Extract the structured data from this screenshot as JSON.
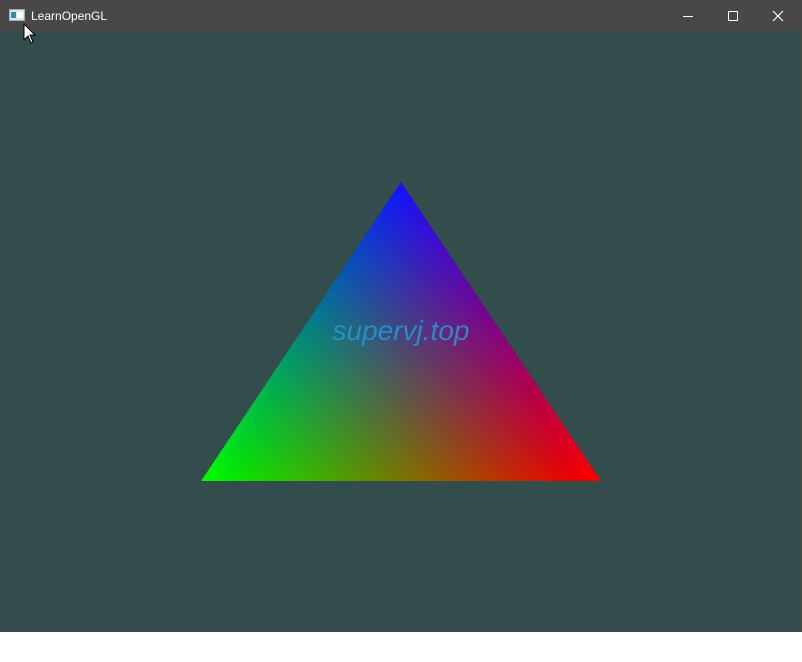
{
  "window": {
    "title": "LearnOpenGL",
    "icon": "opengl-window-icon",
    "controls": {
      "minimize_icon": "minimize-icon",
      "maximize_icon": "maximize-icon",
      "close_icon": "close-icon"
    }
  },
  "scene": {
    "clear_color": "#334d4d",
    "triangle": {
      "vertex_colors": {
        "top": "#0000ff",
        "bottom_left": "#00ff00",
        "bottom_right": "#ff0000"
      }
    },
    "watermark": "supervj.top"
  },
  "cursor": {
    "icon": "arrow-cursor-icon"
  }
}
